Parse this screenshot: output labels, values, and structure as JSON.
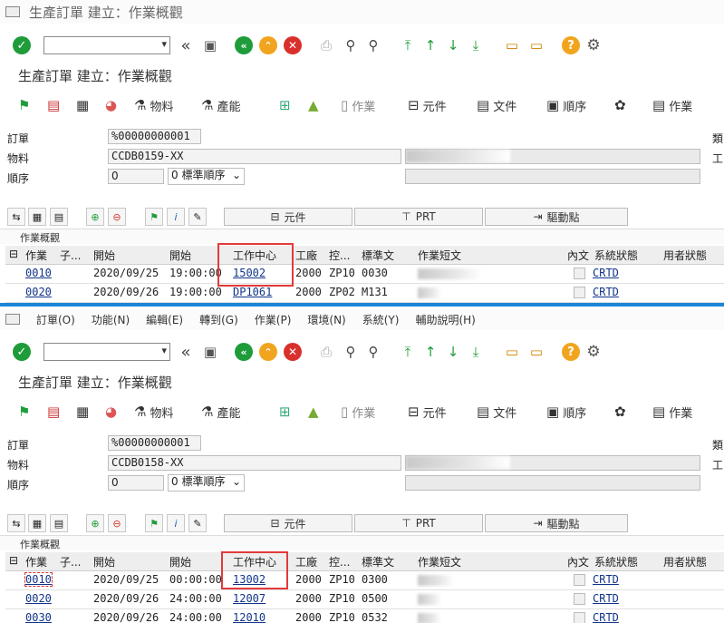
{
  "top": {
    "window_title": "生產訂單 建立：作業概觀",
    "title": "生產訂單 建立：作業概觀",
    "fields": {
      "order_label": "訂單",
      "order": "%00000000001",
      "material_label": "物料",
      "material": "CCDB0159-XX",
      "seq_label": "順序",
      "seq": "0",
      "seq_select": "0 標準順序",
      "right_label_1": "類",
      "right_label_2": "工"
    },
    "ops": [
      {
        "op": "0010",
        "date": "2020/09/25",
        "time": "19:00:00",
        "wc": "15002",
        "plant": "2000",
        "ctl": "ZP10",
        "std": "0030",
        "status": "CRTD"
      },
      {
        "op": "0020",
        "date": "2020/09/26",
        "time": "19:00:00",
        "wc": "DP1061",
        "plant": "2000",
        "ctl": "ZP02",
        "std": "M131",
        "status": "CRTD"
      }
    ]
  },
  "menu": [
    "訂單(O)",
    "功能(N)",
    "編輯(E)",
    "轉到(G)",
    "作業(P)",
    "環境(N)",
    "系統(Y)",
    "輔助說明(H)"
  ],
  "bottom": {
    "title": "生產訂單 建立：作業概觀",
    "fields": {
      "order_label": "訂單",
      "order": "%00000000001",
      "material_label": "物料",
      "material": "CCDB0158-XX",
      "seq_label": "順序",
      "seq": "0",
      "seq_select": "0 標準順序",
      "right_label_1": "類",
      "right_label_2": "工"
    },
    "ops": [
      {
        "op": "0010",
        "date": "2020/09/25",
        "time": "00:00:00",
        "wc": "13002",
        "plant": "2000",
        "ctl": "ZP10",
        "std": "0300",
        "status": "CRTD"
      },
      {
        "op": "0020",
        "date": "2020/09/26",
        "time": "24:00:00",
        "wc": "12007",
        "plant": "2000",
        "ctl": "ZP10",
        "std": "0500",
        "status": "CRTD"
      },
      {
        "op": "0030",
        "date": "2020/09/26",
        "time": "24:00:00",
        "wc": "12010",
        "plant": "2000",
        "ctl": "ZP10",
        "std": "0532",
        "status": "CRTD"
      }
    ]
  },
  "app_toolbar": {
    "material": "物料",
    "capacity": "產能",
    "operation": "作業",
    "component": "元件",
    "document": "文件",
    "sequence": "順序",
    "operation2": "作業"
  },
  "grid_tabs": {
    "component": "元件",
    "prt": "PRT",
    "trigger": "驅動點"
  },
  "section_label": "作業概觀",
  "columns": {
    "op": "作業",
    "sub": "子...",
    "start": "開始",
    "start2": "開始",
    "wc": "工作中心",
    "plant": "工廠",
    "ctl": "控...",
    "std": "標準文",
    "short": "作業短文",
    "intext": "內文",
    "sysstat": "系統狀態",
    "userstat": "用者狀態"
  },
  "colors": {
    "accent_blue": "#1a86d6",
    "red_box": "#e23a3a",
    "green": "#1e9c3a",
    "orange": "#f1a51f",
    "red": "#d9302c"
  }
}
